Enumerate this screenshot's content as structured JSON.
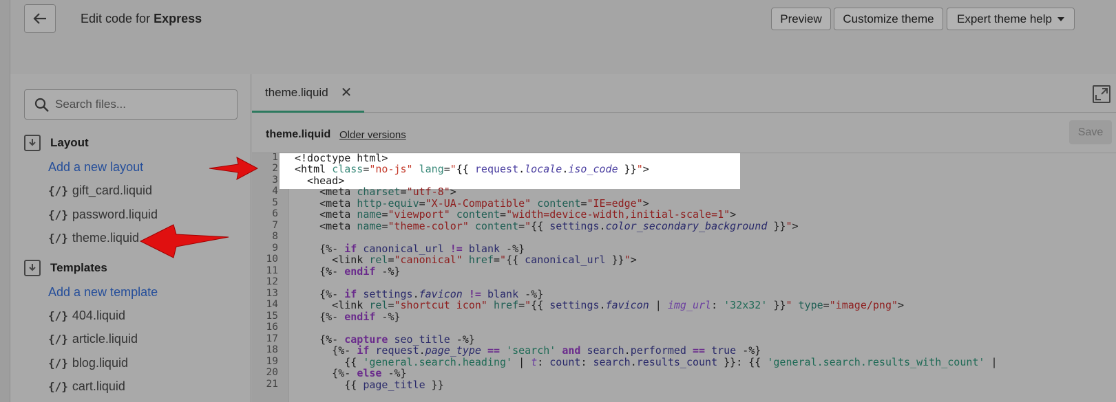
{
  "header": {
    "title_prefix": "Edit code for ",
    "theme_name": "Express",
    "buttons": {
      "preview": "Preview",
      "customize": "Customize theme",
      "help": "Expert theme help"
    }
  },
  "sidebar": {
    "search_placeholder": "Search files...",
    "layout": {
      "heading": "Layout",
      "add_link": "Add a new layout",
      "files": [
        "gift_card.liquid",
        "password.liquid",
        "theme.liquid"
      ]
    },
    "templates": {
      "heading": "Templates",
      "add_link": "Add a new template",
      "files": [
        "404.liquid",
        "article.liquid",
        "blog.liquid",
        "cart.liquid"
      ]
    },
    "liquid_glyph": "{/}"
  },
  "editor": {
    "tab_label": "theme.liquid",
    "file_name": "theme.liquid",
    "older_versions": "Older versions",
    "save": "Save",
    "line_numbers": [
      "1",
      "2",
      "3",
      "4",
      "5",
      "6",
      "7",
      "8",
      "9",
      "10",
      "11",
      "12",
      "13",
      "14",
      "15",
      "16",
      "17",
      "18",
      "19",
      "20",
      "21"
    ]
  },
  "colors": {
    "accent_tab": "#2d7a5f",
    "link": "#254e9a",
    "arrow": "#e01010",
    "highlight": "#ffffff"
  }
}
